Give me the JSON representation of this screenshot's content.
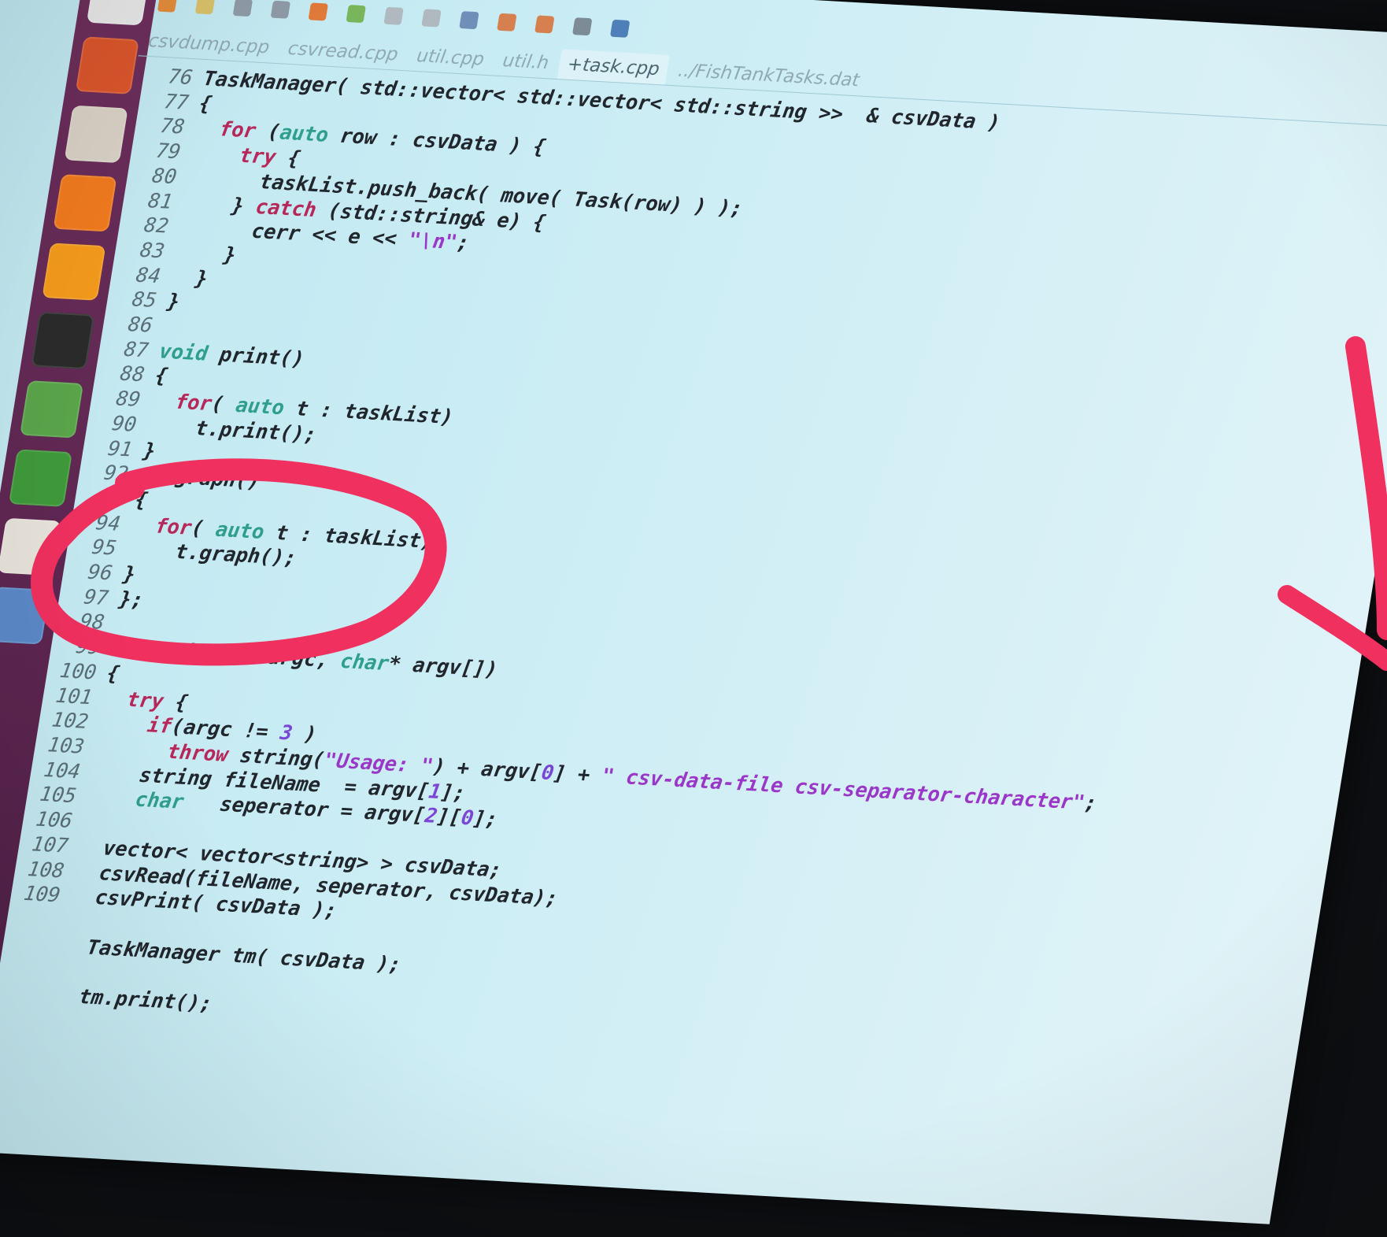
{
  "tabs": [
    {
      "label": "csvdump.cpp"
    },
    {
      "label": "csvread.cpp"
    },
    {
      "label": "util.cpp"
    },
    {
      "label": "util.h"
    },
    {
      "label": "+task.cpp"
    },
    {
      "label": "../FishTankTasks.dat"
    }
  ],
  "launcher_icons": [
    "ubuntu-icon",
    "settings-icon",
    "files-icon",
    "firefox-icon",
    "vlc-icon",
    "terminal-icon",
    "spreadsheet-icon",
    "vim-icon",
    "presentation-icon",
    "document-icon"
  ],
  "toolbar_icons": [
    "new-icon",
    "open-icon",
    "save-icon",
    "print-icon",
    "undo-icon",
    "redo-icon",
    "cut-icon",
    "copy-icon",
    "find-icon",
    "back-icon",
    "forward-icon",
    "run-icon",
    "build-icon"
  ],
  "code_lines": [
    {
      "n": "76",
      "parts": [
        [
          "",
          "TaskManager( std::vector< std::vector< std::string >>  & csvData )"
        ]
      ]
    },
    {
      "n": "77",
      "parts": [
        [
          "",
          "{"
        ]
      ]
    },
    {
      "n": "78",
      "parts": [
        [
          "",
          "  "
        ],
        [
          "kw",
          "for"
        ],
        [
          "",
          " ("
        ],
        [
          "ty",
          "auto"
        ],
        [
          "",
          " row : csvData ) {"
        ]
      ]
    },
    {
      "n": "79",
      "parts": [
        [
          "",
          "    "
        ],
        [
          "kw",
          "try"
        ],
        [
          "",
          " {"
        ]
      ]
    },
    {
      "n": "80",
      "parts": [
        [
          "",
          "      taskList.push_back( move( Task(row) ) );"
        ]
      ]
    },
    {
      "n": "81",
      "parts": [
        [
          "",
          "    } "
        ],
        [
          "kw",
          "catch"
        ],
        [
          "",
          " (std::string& e) {"
        ]
      ]
    },
    {
      "n": "82",
      "parts": [
        [
          "",
          "      cerr << e << "
        ],
        [
          "str",
          "\"\\n\""
        ],
        [
          "",
          ";"
        ]
      ]
    },
    {
      "n": "83",
      "parts": [
        [
          "",
          "    }"
        ]
      ]
    },
    {
      "n": "84",
      "parts": [
        [
          "",
          "  }"
        ]
      ]
    },
    {
      "n": "85",
      "parts": [
        [
          "",
          "}"
        ]
      ]
    },
    {
      "n": "86",
      "parts": [
        [
          "",
          ""
        ]
      ]
    },
    {
      "n": "87",
      "parts": [
        [
          "ty",
          "void"
        ],
        [
          "",
          " print()"
        ]
      ]
    },
    {
      "n": "88",
      "parts": [
        [
          "",
          "{"
        ]
      ]
    },
    {
      "n": "89",
      "parts": [
        [
          "",
          "  "
        ],
        [
          "kw",
          "for"
        ],
        [
          "",
          "( "
        ],
        [
          "ty",
          "auto"
        ],
        [
          "",
          " t : taskList)"
        ]
      ]
    },
    {
      "n": "90",
      "parts": [
        [
          "",
          "    t.print();"
        ]
      ]
    },
    {
      "n": "91",
      "parts": [
        [
          "",
          "}"
        ]
      ]
    },
    {
      "n": "92",
      "parts": [
        [
          "",
          "   graph()"
        ]
      ]
    },
    {
      "n": "93",
      "parts": [
        [
          "",
          "{"
        ]
      ]
    },
    {
      "n": "94",
      "parts": [
        [
          "",
          "  "
        ],
        [
          "kw",
          "for"
        ],
        [
          "",
          "( "
        ],
        [
          "ty",
          "auto"
        ],
        [
          "",
          " t : taskList)"
        ]
      ]
    },
    {
      "n": "95",
      "parts": [
        [
          "",
          "    t.graph();"
        ]
      ]
    },
    {
      "n": "96",
      "parts": [
        [
          "",
          "}"
        ]
      ]
    },
    {
      "n": "97",
      "parts": [
        [
          "",
          "};"
        ]
      ]
    },
    {
      "n": "98",
      "parts": [
        [
          "",
          ""
        ]
      ]
    },
    {
      "n": "99",
      "parts": [
        [
          "ty",
          "int"
        ],
        [
          "",
          " main("
        ],
        [
          "ty",
          "int"
        ],
        [
          "",
          " argc, "
        ],
        [
          "ty",
          "char"
        ],
        [
          "",
          "* argv[])"
        ]
      ]
    },
    {
      "n": "100",
      "parts": [
        [
          "",
          "{"
        ]
      ]
    },
    {
      "n": "101",
      "parts": [
        [
          "",
          "  "
        ],
        [
          "kw",
          "try"
        ],
        [
          "",
          " {"
        ]
      ]
    },
    {
      "n": "102",
      "parts": [
        [
          "",
          "    "
        ],
        [
          "kw",
          "if"
        ],
        [
          "",
          "(argc != "
        ],
        [
          "nm",
          "3"
        ],
        [
          "",
          " )"
        ]
      ]
    },
    {
      "n": "103",
      "parts": [
        [
          "",
          "      "
        ],
        [
          "kw",
          "throw"
        ],
        [
          "",
          " string("
        ],
        [
          "str",
          "\"Usage: \""
        ],
        [
          "",
          ") + argv["
        ],
        [
          "nm",
          "0"
        ],
        [
          "",
          "] + "
        ],
        [
          "str",
          "\" csv-data-file csv-separator-character\""
        ],
        [
          "",
          ";"
        ]
      ]
    },
    {
      "n": "104",
      "parts": [
        [
          "",
          "    string fileName  = argv["
        ],
        [
          "nm",
          "1"
        ],
        [
          "",
          "];"
        ]
      ]
    },
    {
      "n": "105",
      "parts": [
        [
          "",
          "    "
        ],
        [
          "ty",
          "char"
        ],
        [
          "",
          "   seperator = argv["
        ],
        [
          "nm",
          "2"
        ],
        [
          "",
          "]["
        ],
        [
          "nm",
          "0"
        ],
        [
          "",
          "];"
        ]
      ]
    },
    {
      "n": "106",
      "parts": [
        [
          "",
          ""
        ]
      ]
    },
    {
      "n": "107",
      "parts": [
        [
          "",
          "  vector< vector<string> > csvData;"
        ]
      ]
    },
    {
      "n": "108",
      "parts": [
        [
          "",
          "  csvRead(fileName, seperator, csvData);"
        ]
      ]
    },
    {
      "n": "109",
      "parts": [
        [
          "",
          "  csvPrint( csvData );"
        ]
      ]
    },
    {
      "n": "",
      "parts": [
        [
          "",
          ""
        ]
      ]
    },
    {
      "n": "",
      "parts": [
        [
          "",
          "  TaskManager tm( csvData );"
        ]
      ]
    },
    {
      "n": "",
      "parts": [
        [
          "",
          ""
        ]
      ]
    },
    {
      "n": "",
      "parts": [
        [
          "",
          "  tm.print();"
        ]
      ]
    }
  ],
  "colors": {
    "annotation": "#f0305f",
    "keyword": "#b7285a",
    "type": "#2f9e8d",
    "string": "#9a37c8",
    "background": "#c9ecf4"
  }
}
